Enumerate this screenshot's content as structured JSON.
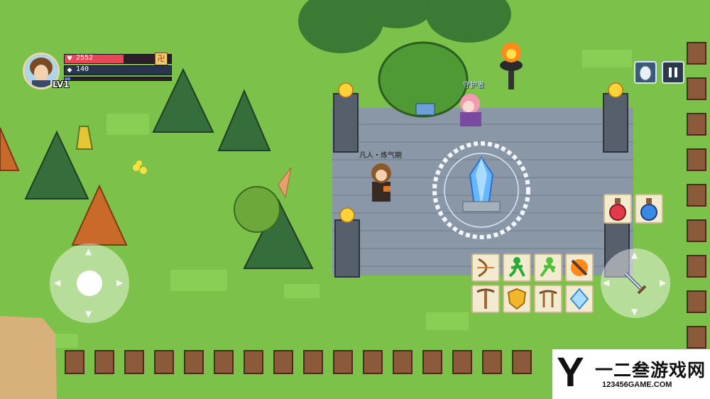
{
  "player": {
    "hp": "2552",
    "hp_fraction": 0.55,
    "mp": "140",
    "mp_fraction": 1.0,
    "exp_fraction": 0.05,
    "level": "LV1",
    "name": "凡人・炼气期"
  },
  "npc": {
    "name": "守护者"
  },
  "skills": [
    "bow-shot-icon",
    "green-runner-icon",
    "green-dash-icon",
    "fire-sword-icon",
    "crossbow-icon",
    "golden-shield-icon",
    "multi-crossbow-icon",
    "ice-crystal-icon"
  ],
  "potions": [
    "red-potion-icon",
    "blue-potion-icon"
  ],
  "watermark": {
    "logo": "Y",
    "title": "一二叁游戏网",
    "url": "123456GAME.COM"
  },
  "colors": {
    "grass": "#7cc24a",
    "stone": "#8a97a6",
    "hp": "#e8475a",
    "mp": "#27364e",
    "exp": "#5b7bd9"
  }
}
